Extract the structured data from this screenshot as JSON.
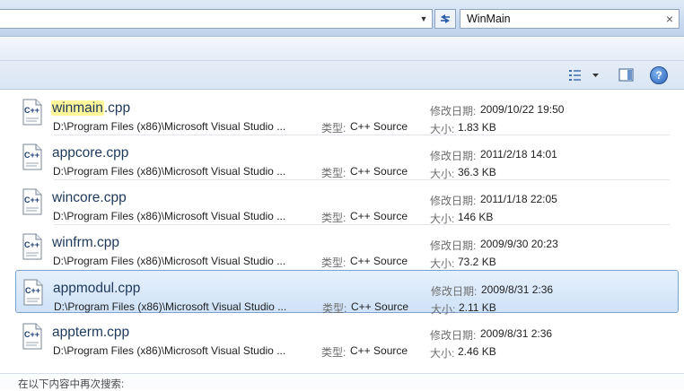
{
  "search": {
    "query": "WinMain",
    "clear_symbol": "×"
  },
  "toolbar": {
    "help_glyph": "?"
  },
  "labels": {
    "modified": "修改日期:",
    "size": "大小:",
    "type": "类型:"
  },
  "results": [
    {
      "name_highlight": "winmain",
      "name_rest": ".cpp",
      "path": "D:\\Program Files (x86)\\Microsoft Visual Studio ...",
      "type": "C++ Source",
      "modified": "2009/10/22 19:50",
      "size": "1.83 KB"
    },
    {
      "name_highlight": "",
      "name_rest": "appcore.cpp",
      "path": "D:\\Program Files (x86)\\Microsoft Visual Studio ...",
      "type": "C++ Source",
      "modified": "2011/2/18 14:01",
      "size": "36.3 KB"
    },
    {
      "name_highlight": "",
      "name_rest": "wincore.cpp",
      "path": "D:\\Program Files (x86)\\Microsoft Visual Studio ...",
      "type": "C++ Source",
      "modified": "2011/1/18 22:05",
      "size": "146 KB"
    },
    {
      "name_highlight": "",
      "name_rest": "winfrm.cpp",
      "path": "D:\\Program Files (x86)\\Microsoft Visual Studio ...",
      "type": "C++ Source",
      "modified": "2009/9/30 20:23",
      "size": "73.2 KB"
    },
    {
      "name_highlight": "",
      "name_rest": "appmodul.cpp",
      "path": "D:\\Program Files (x86)\\Microsoft Visual Studio ...",
      "type": "C++ Source",
      "modified": "2009/8/31 2:36",
      "size": "2.11 KB"
    },
    {
      "name_highlight": "",
      "name_rest": "appterm.cpp",
      "path": "D:\\Program Files (x86)\\Microsoft Visual Studio ...",
      "type": "C++ Source",
      "modified": "2009/8/31 2:36",
      "size": "2.46 KB"
    }
  ],
  "selected_index": 4,
  "file_icon_text": "C++",
  "footer": {
    "search_again": "在以下内容中再次搜索:"
  },
  "colors": {
    "highlight": "#fff59a",
    "selection": "#cfe2f8",
    "name_text": "#1e395b"
  }
}
